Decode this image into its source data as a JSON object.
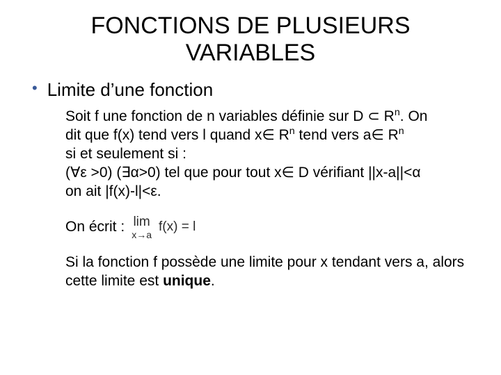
{
  "title": "FONCTIONS DE PLUSIEURS VARIABLES",
  "bullet1": "Limite d’une fonction",
  "definition": {
    "l1a": "Soit f une fonction de n variables définie sur D ⊂ R",
    "l1sup": "n",
    "l1b": ". On",
    "l2a": "dit que f(x) tend vers l quand x∈ R",
    "l2sup": "n",
    "l2b": " tend vers a∈ R",
    "l2sup2": "n",
    "l3": "si et seulement si :",
    "l4": "(∀ε >0) (∃α>0) tel que pour tout x∈ D vérifiant ||x-a||<α",
    "l5": "on ait |f(x)-l|<ε."
  },
  "write_label": "On écrit :",
  "limit": {
    "top": "lim",
    "bot": "x→a",
    "expr": "f(x) = l"
  },
  "unique": {
    "a": "Si la fonction f possède une limite pour x tendant vers a, alors cette limite est ",
    "b": "unique",
    "c": "."
  }
}
